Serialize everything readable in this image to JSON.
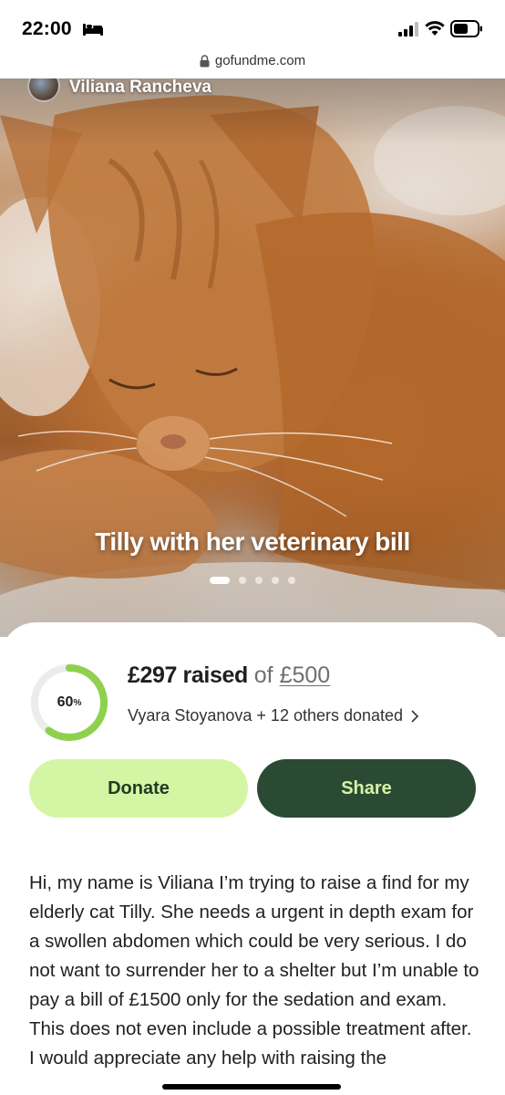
{
  "status_bar": {
    "time": "22:00",
    "icons": [
      "bed-icon",
      "signal-icon",
      "wifi-icon",
      "battery-icon"
    ]
  },
  "browser": {
    "url": "gofundme.com",
    "icon": "lock-icon"
  },
  "hero": {
    "organizer_name": "Viliana Rancheva",
    "caption": "Tilly with her veterinary bill",
    "slides_count": 5,
    "active_slide": 1
  },
  "fundraiser": {
    "progress_percent": 60,
    "progress_label": "60",
    "progress_unit": "%",
    "raised_amount": "£297 raised",
    "of_text": "of",
    "goal_amount": "£500",
    "donors_text": "Vyara Stoyanova + 12 others donated",
    "accent_color": "#8fd14f",
    "track_color": "#ececec"
  },
  "actions": {
    "donate_label": "Donate",
    "share_label": "Share"
  },
  "story": {
    "paragraph_1": "Hi, my name is Viliana I’m trying to raise a find for my elderly cat Tilly. She needs a urgent in depth exam for a swollen abdomen which could be very serious. I do not want to surrender her to a shelter but I’m unable to pay a bill of £1500 only for the sedation and exam. This does not even include a possible treatment after.",
    "paragraph_2": "I would appreciate any help with raising the"
  }
}
